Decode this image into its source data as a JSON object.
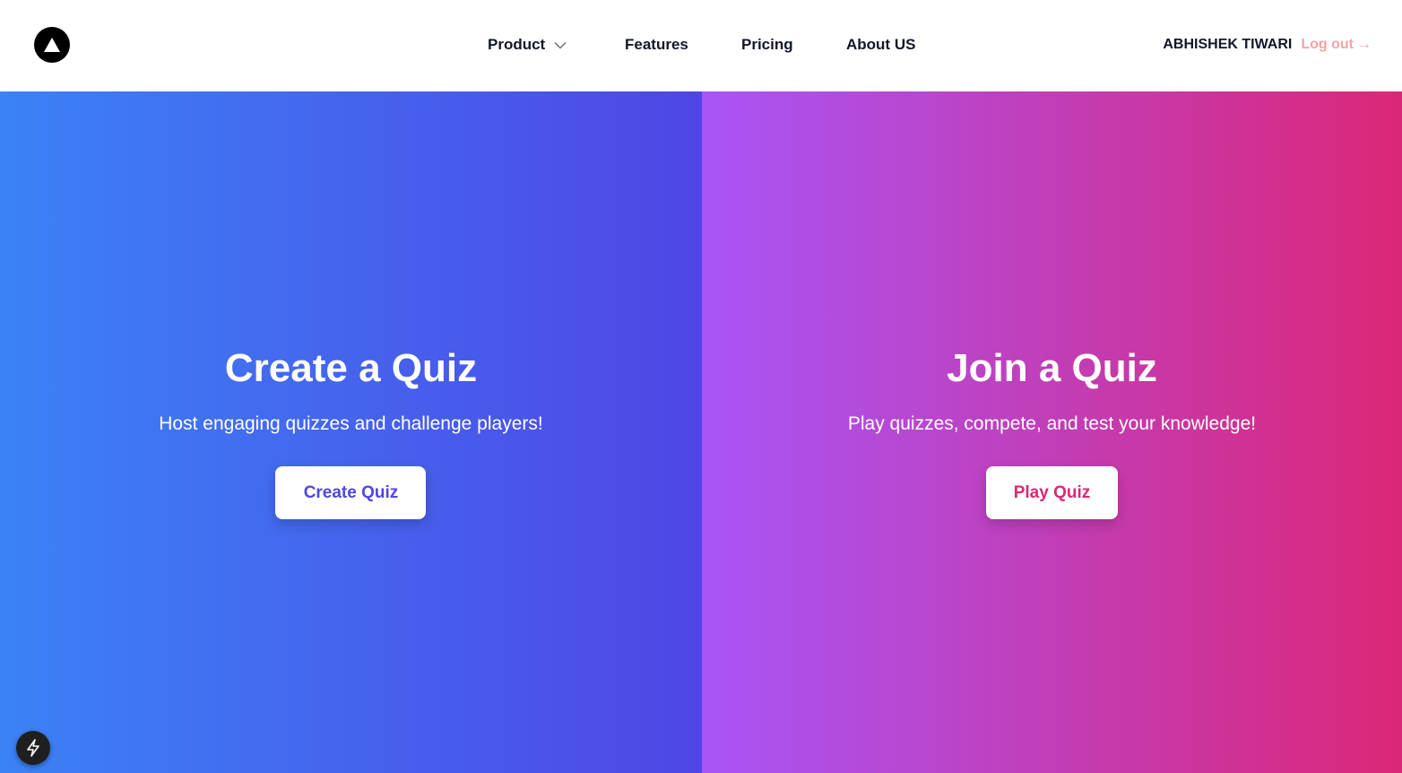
{
  "nav": {
    "logo_icon": "triangle-logo-icon",
    "links": [
      {
        "label": "Product",
        "has_dropdown": true
      },
      {
        "label": "Features"
      },
      {
        "label": "Pricing"
      },
      {
        "label": "About US"
      }
    ],
    "user_name": "ABHISHEK TIWARI",
    "logout_label": "Log out",
    "logout_arrow": "→"
  },
  "panels": {
    "create": {
      "title": "Create a Quiz",
      "subtitle": "Host engaging quizzes and challenge players!",
      "button_label": "Create Quiz"
    },
    "join": {
      "title": "Join a Quiz",
      "subtitle": "Play quizzes, compete, and test your knowledge!",
      "button_label": "Play Quiz"
    }
  },
  "colors": {
    "left_gradient": [
      "#3b82f6",
      "#4f46e5"
    ],
    "right_gradient": [
      "#a855f7",
      "#db2777"
    ],
    "logout": "#f4a3a8"
  },
  "badge_icon": "lightning-icon"
}
